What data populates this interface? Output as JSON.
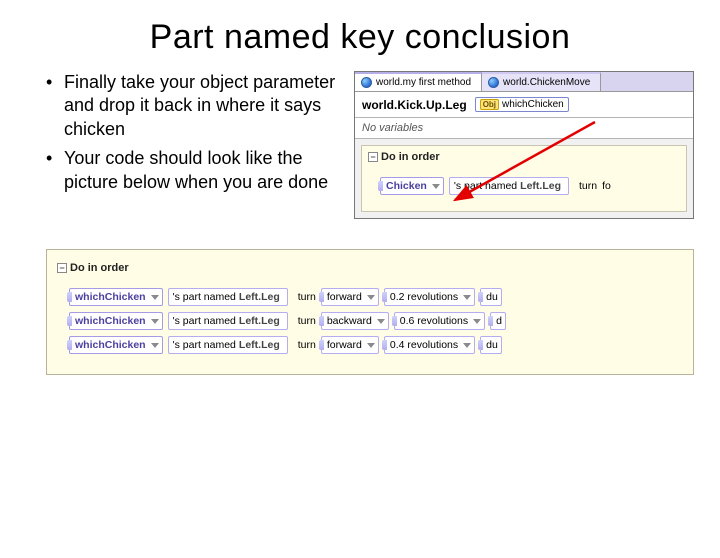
{
  "title": "Part named key conclusion",
  "bullets": [
    "Finally take your object parameter and drop it back in where it says chicken",
    "Your code should look like the picture below when you are done"
  ],
  "alice_top": {
    "tabs": [
      {
        "label": "world.my first method"
      },
      {
        "label": "world.ChickenMove"
      }
    ],
    "method_name": "world.Kick.Up.Leg",
    "param_badge": "Obj",
    "param_name": "whichChicken",
    "no_vars": "No variables",
    "do_header": "Do in order",
    "stmt": {
      "subject": "Chicken",
      "part_prefix": "'s part named",
      "part_name": "Left.Leg",
      "action": "turn",
      "dir": "fo"
    }
  },
  "alice_bottom": {
    "do_header": "Do in order",
    "rows": [
      {
        "subject": "whichChicken",
        "part_prefix": "'s part named",
        "part_name": "Left.Leg",
        "action": "turn",
        "dir": "forward",
        "amount": "0.2 revolutions",
        "more": "du"
      },
      {
        "subject": "whichChicken",
        "part_prefix": "'s part named",
        "part_name": "Left.Leg",
        "action": "turn",
        "dir": "backward",
        "amount": "0.6 revolutions",
        "more": "d"
      },
      {
        "subject": "whichChicken",
        "part_prefix": "'s part named",
        "part_name": "Left.Leg",
        "action": "turn",
        "dir": "forward",
        "amount": "0.4 revolutions",
        "more": "du"
      }
    ]
  }
}
